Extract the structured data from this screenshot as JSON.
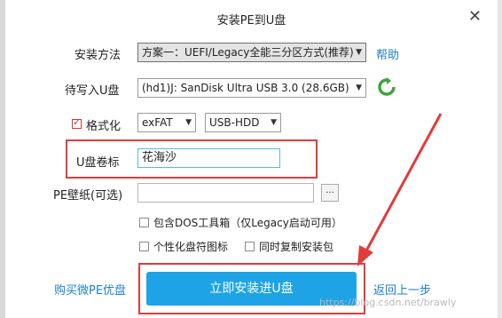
{
  "window": {
    "title": "安装PE到U盘",
    "close_glyph": "✕"
  },
  "install_method": {
    "label": "安装方法",
    "selected": "方案一：UEFI/Legacy全能三分区方式(推荐)",
    "help_link": "帮助"
  },
  "target_disk": {
    "label": "待写入U盘",
    "selected": "(hd1)J: SanDisk Ultra USB 3.0 (28.6GB)"
  },
  "format": {
    "label": "格式化",
    "checked": true,
    "filesystem": "exFAT",
    "mode": "USB-HDD"
  },
  "volume": {
    "label": "U盘卷标",
    "value": "花海沙"
  },
  "wallpaper": {
    "label": "PE壁纸(可选)",
    "value": "",
    "browse_label": "..."
  },
  "options": {
    "dos_toolbox": "包含DOS工具箱（仅Legacy启动可用）",
    "personalize_icon": "个性化盘符图标",
    "copy_installer": "同时复制安装包"
  },
  "footer": {
    "buy_link": "购买微PE优盘",
    "install_button": "立即安装进U盘",
    "back_link": "返回上一步"
  },
  "watermark": "https://blog.csdn.net/brawly",
  "colors": {
    "accent": "#1ea4e6",
    "annotation": "#e23b3b",
    "link": "#1c7fcf"
  }
}
